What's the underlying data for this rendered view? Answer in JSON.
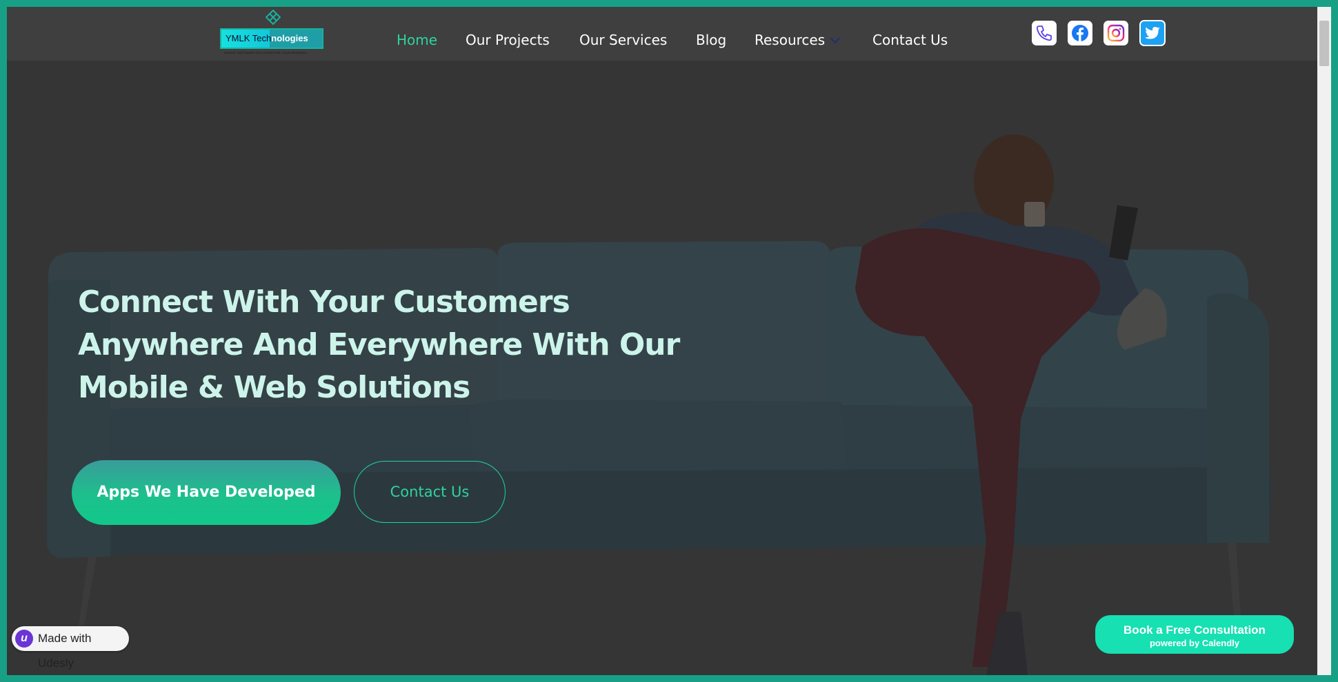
{
  "brand": {
    "name_part1": "YMLK Tech",
    "name_part2": "nologies",
    "tagline": "UNIQUE SOFTWARE SOLUTIONS FOR YOUR BUSINESS"
  },
  "nav": {
    "items": [
      {
        "label": "Home",
        "active": true
      },
      {
        "label": "Our Projects"
      },
      {
        "label": "Our Services"
      },
      {
        "label": "Blog"
      },
      {
        "label": "Resources",
        "has_dropdown": true
      },
      {
        "label": "Contact Us"
      }
    ]
  },
  "social": [
    {
      "name": "phone-icon"
    },
    {
      "name": "facebook-icon"
    },
    {
      "name": "instagram-icon"
    },
    {
      "name": "twitter-icon"
    }
  ],
  "hero": {
    "headline": "Connect With Your Customers Anywhere And Everywhere With Our Mobile & Web Solutions",
    "primary_button": "Apps We Have Developed",
    "secondary_button": "Contact Us"
  },
  "badge": {
    "udesly_letter": "u",
    "udesly_text": "Made with Udesly"
  },
  "calendly": {
    "title": "Book a Free Consultation",
    "subtitle": "powered by Calendly"
  },
  "colors": {
    "accent": "#2fd3a0",
    "frame": "#17a085",
    "headline": "#cdf4ea",
    "calendly": "#17e0b3"
  }
}
